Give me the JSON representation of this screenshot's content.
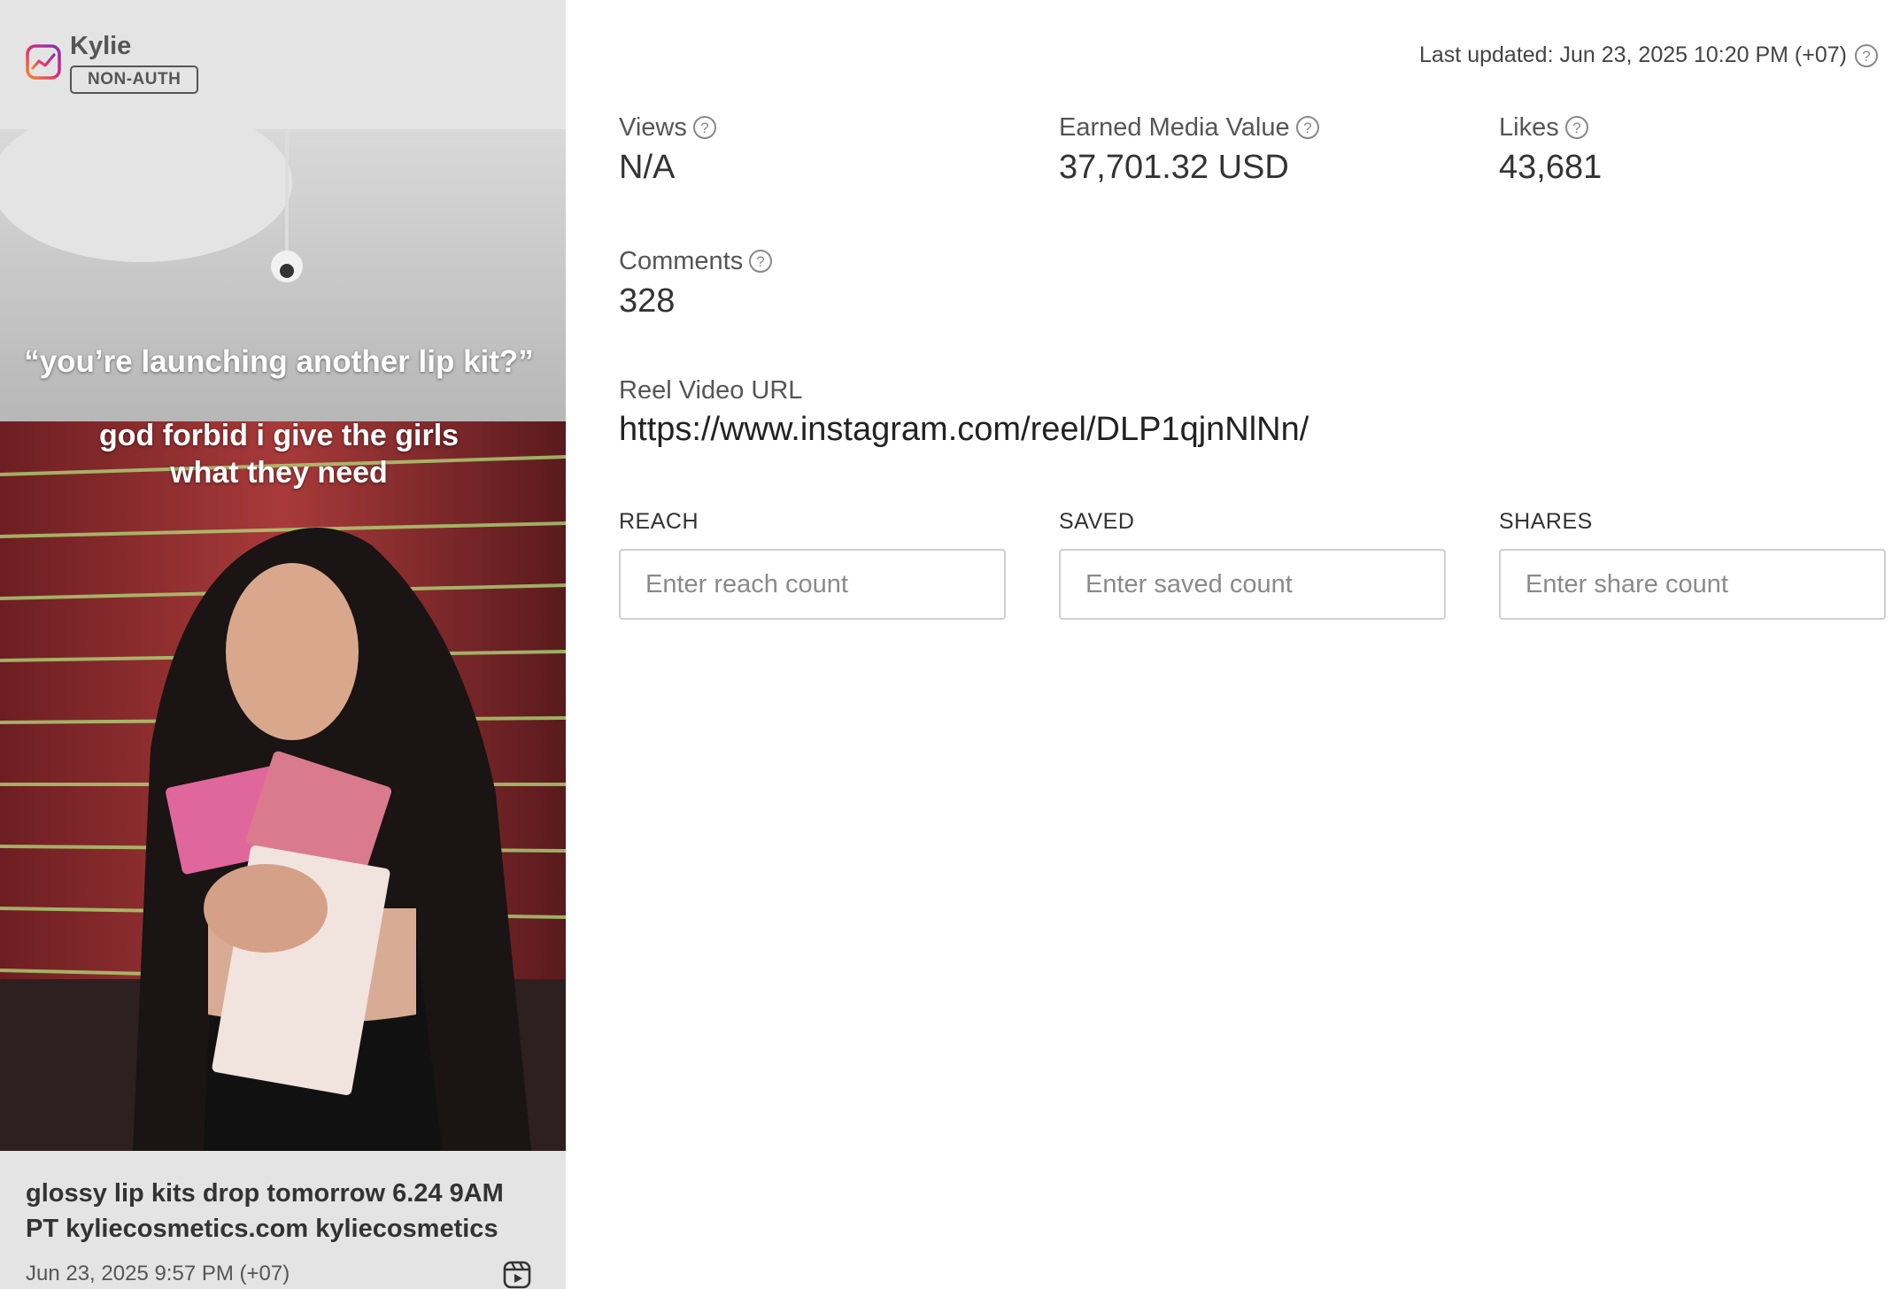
{
  "account": {
    "name": "Kylie",
    "auth_badge": "NON-AUTH"
  },
  "media": {
    "overlay_quote": "“you’re launching another lip kit?”",
    "overlay_line_1": "god forbid i give the girls",
    "overlay_line_2": "what they need"
  },
  "post": {
    "caption": "glossy lip kits drop tomorrow 6.24 9AM PT kyliecosmetics.com kyliecosmetics",
    "date": "Jun 23, 2025 9:57 PM (+07)"
  },
  "header": {
    "last_updated_label": "Last updated:",
    "last_updated_value": "Jun 23, 2025 10:20 PM (+07)"
  },
  "metrics": {
    "views": {
      "label": "Views",
      "value": "N/A"
    },
    "emv": {
      "label": "Earned Media Value",
      "value": "37,701.32 USD"
    },
    "likes": {
      "label": "Likes",
      "value": "43,681"
    },
    "comments": {
      "label": "Comments",
      "value": "328"
    }
  },
  "reel": {
    "label": "Reel Video URL",
    "url": "https://www.instagram.com/reel/DLP1qjnNlNn/"
  },
  "inputs": {
    "reach": {
      "label": "REACH",
      "placeholder": "Enter reach count"
    },
    "saved": {
      "label": "SAVED",
      "placeholder": "Enter saved count"
    },
    "shares": {
      "label": "SHARES",
      "placeholder": "Enter share count"
    }
  },
  "icons": {
    "platform": "instagram-icon",
    "help": "question-circle-icon",
    "reel": "reel-icon"
  },
  "colors": {
    "left_panel_bg": "#e4e4e4",
    "instagram_gradient_start": "#f58529",
    "instagram_gradient_end": "#dd2a7b"
  }
}
